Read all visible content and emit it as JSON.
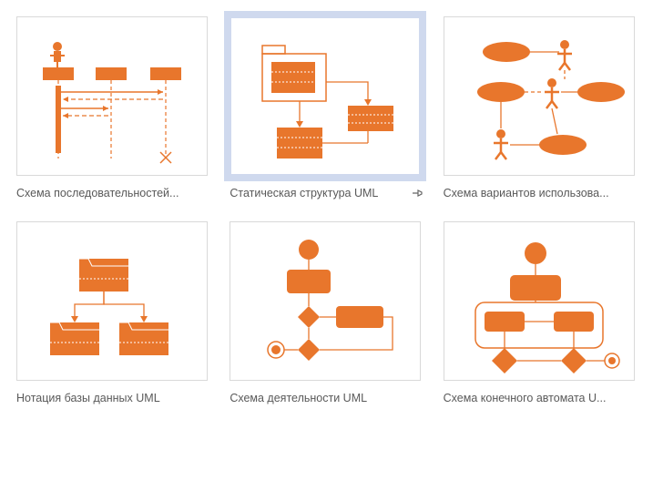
{
  "colors": {
    "orange": "#e8762c",
    "selection_border": "#8ea5d8",
    "selection_fill": "#cfd9ee",
    "caption": "#595959",
    "tile_border": "#d9d9d9"
  },
  "templates": [
    {
      "id": "sequence",
      "label": "Схема последовательностей...",
      "selected": false,
      "pinned": false,
      "icon": "uml-sequence-diagram-icon"
    },
    {
      "id": "static-structure",
      "label": "Статическая структура UML",
      "selected": true,
      "pinned": true,
      "icon": "uml-static-structure-icon"
    },
    {
      "id": "use-case",
      "label": "Схема вариантов использова...",
      "selected": false,
      "pinned": false,
      "icon": "uml-use-case-icon"
    },
    {
      "id": "database",
      "label": "Нотация базы данных UML",
      "selected": false,
      "pinned": false,
      "icon": "uml-database-notation-icon"
    },
    {
      "id": "activity",
      "label": "Схема деятельности UML",
      "selected": false,
      "pinned": false,
      "icon": "uml-activity-diagram-icon"
    },
    {
      "id": "state-machine",
      "label": "Схема конечного автомата U...",
      "selected": false,
      "pinned": false,
      "icon": "uml-state-machine-icon"
    }
  ]
}
